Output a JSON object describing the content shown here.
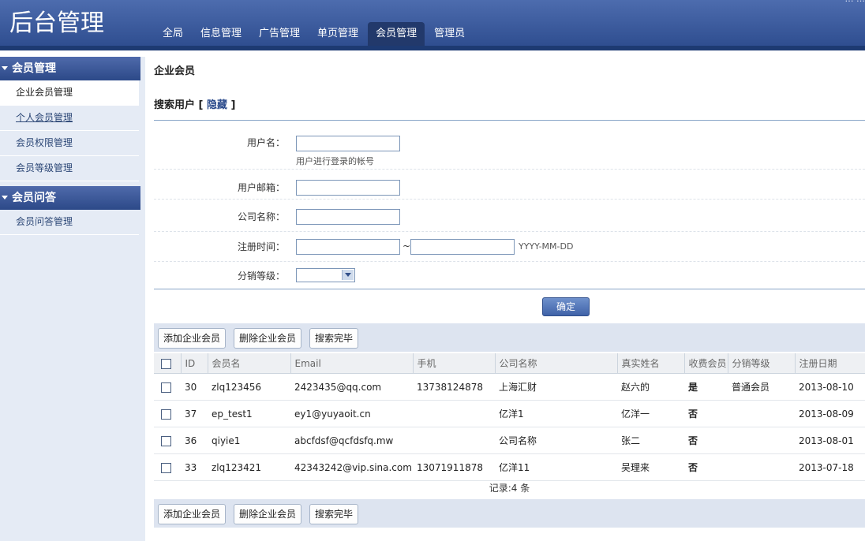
{
  "header": {
    "logo": "后台管理",
    "top_links": "… …",
    "nav": [
      "全局",
      "信息管理",
      "广告管理",
      "单页管理",
      "会员管理",
      "管理员"
    ],
    "active_nav": 4
  },
  "sidebar": {
    "groups": [
      {
        "title": "会员管理",
        "items": [
          "企业会员管理",
          "个人会员管理",
          "会员权限管理",
          "会员等级管理"
        ]
      },
      {
        "title": "会员问答",
        "items": [
          "会员问答管理"
        ]
      }
    ]
  },
  "main": {
    "page_title": "企业会员",
    "search_title": "搜索用户",
    "toggle_label": "隐藏",
    "form": {
      "username_label": "用户名：",
      "username_hint": "用户进行登录的帐号",
      "email_label": "用户邮箱：",
      "company_label": "公司名称：",
      "regtime_label": "注册时间：",
      "range_sep": "~",
      "date_format": "YYYY-MM-DD",
      "level_label": "分销等级："
    },
    "confirm_label": "确定",
    "toolbar": {
      "add": "添加企业会员",
      "delete": "删除企业会员",
      "done": "搜索完毕"
    },
    "table": {
      "headers": [
        "ID",
        "会员名",
        "Email",
        "手机",
        "公司名称",
        "真实姓名",
        "收费会员",
        "分销等级",
        "注册日期"
      ],
      "rows": [
        [
          "30",
          "zlq123456",
          "2423435@qq.com",
          "13738124878",
          "上海汇财",
          "赵六的",
          "是",
          "普通会员",
          "2013-08-10"
        ],
        [
          "37",
          "ep_test1",
          "ey1@yuyaoit.cn",
          "",
          "亿洋1",
          "亿洋一",
          "否",
          "",
          "2013-08-09"
        ],
        [
          "36",
          "qiyie1",
          "abcfdsf@qcfdsfq.mw",
          "",
          "公司名称",
          "张二",
          "否",
          "",
          "2013-08-01"
        ],
        [
          "33",
          "zlq123421",
          "42343242@vip.sina.com",
          "13071911878",
          "亿洋11",
          "吴理来",
          "否",
          "",
          "2013-07-18"
        ]
      ]
    },
    "record_text": "记录:4 条"
  }
}
